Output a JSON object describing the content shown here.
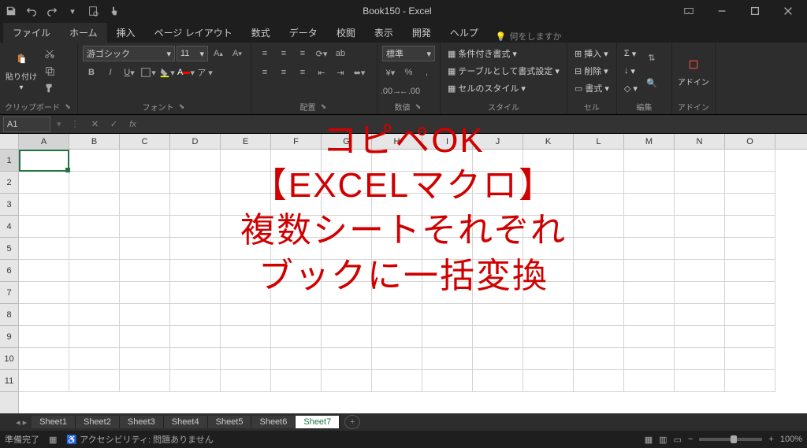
{
  "titlebar": {
    "title": "Book150 - Excel"
  },
  "tabs": {
    "file": "ファイル",
    "home": "ホーム",
    "insert": "挿入",
    "layout": "ページ レイアウト",
    "formulas": "数式",
    "data": "データ",
    "review": "校閲",
    "view": "表示",
    "developer": "開発",
    "help": "ヘルプ",
    "tellme": "何をしますか"
  },
  "ribbon": {
    "clipboard": {
      "paste": "貼り付け",
      "label": "クリップボード"
    },
    "font": {
      "name": "游ゴシック",
      "size": "11",
      "label": "フォント"
    },
    "alignment": {
      "wrap": "ab",
      "label": "配置"
    },
    "number": {
      "format": "標準",
      "label": "数値"
    },
    "styles": {
      "cond": "条件付き書式",
      "table": "テーブルとして書式設定",
      "cell": "セルのスタイル",
      "label": "スタイル"
    },
    "cells": {
      "insert": "挿入",
      "delete": "削除",
      "format": "書式",
      "label": "セル"
    },
    "editing": {
      "label": "編集"
    },
    "addins": {
      "btn": "アドイン",
      "label": "アドイン"
    }
  },
  "namebox": "A1",
  "columns": [
    "A",
    "B",
    "C",
    "D",
    "E",
    "F",
    "G",
    "H",
    "I",
    "J",
    "K",
    "L",
    "M",
    "N",
    "O"
  ],
  "rows": [
    "1",
    "2",
    "3",
    "4",
    "5",
    "6",
    "7",
    "8",
    "9",
    "10",
    "11"
  ],
  "sheets": [
    "Sheet1",
    "Sheet2",
    "Sheet3",
    "Sheet4",
    "Sheet5",
    "Sheet6",
    "Sheet7"
  ],
  "active_sheet": 6,
  "status": {
    "ready": "準備完了",
    "access": "アクセシビリティ: 問題ありません",
    "zoom": "100%"
  },
  "overlay": {
    "l1": "コピペOK",
    "l2": "【EXCELマクロ】",
    "l3": "複数シートそれぞれ",
    "l4": "ブックに一括変換"
  }
}
